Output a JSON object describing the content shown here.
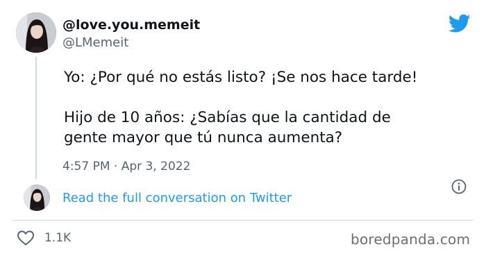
{
  "author": {
    "display_name": "@love.you.memeit",
    "handle": "@LMemeit"
  },
  "tweet": {
    "line1": "Yo: ¿Por qué no estás listo? ¡Se nos hace tarde!",
    "line2": "Hijo de 10 años: ¿Sabías que la cantidad de",
    "line3": "gente mayor que tú nunca aumenta?",
    "timestamp": "4:57 PM · Apr 3, 2022"
  },
  "conversation_link": "Read the full conversation on Twitter",
  "likes": "1.1K",
  "watermark": "boredpanda.com",
  "icons": {
    "brand": "twitter-bird-icon",
    "info": "info-icon",
    "like": "heart-icon"
  },
  "colors": {
    "twitter_blue": "#1d9bf0",
    "secondary_text": "#536471",
    "divider": "#cfd9de"
  }
}
